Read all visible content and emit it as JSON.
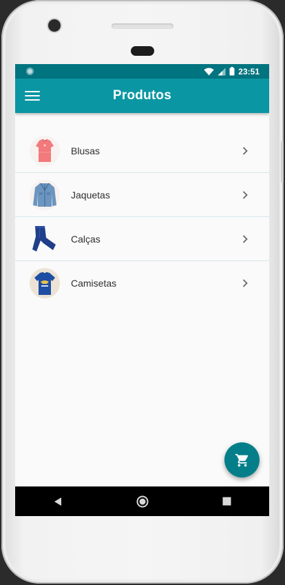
{
  "status_bar": {
    "time": "23:51",
    "icons": [
      "notification-dot-icon",
      "wifi-icon",
      "signal-icon",
      "battery-icon"
    ]
  },
  "app_bar": {
    "title": "Produtos",
    "menu_icon": "hamburger-menu-icon"
  },
  "products": [
    {
      "label": "Blusas",
      "image": "blouse-image"
    },
    {
      "label": "Jaquetas",
      "image": "denim-jacket-image"
    },
    {
      "label": "Calças",
      "image": "jeans-image"
    },
    {
      "label": "Camisetas",
      "image": "tshirt-image"
    }
  ],
  "fab": {
    "icon": "cart-icon"
  },
  "navigation_bar": {
    "buttons": [
      "back-icon",
      "home-icon",
      "recents-icon"
    ]
  },
  "colors": {
    "status_bar": "#00747f",
    "app_bar": "#0a97a3",
    "fab": "#047f8a",
    "background": "#fafafa"
  }
}
